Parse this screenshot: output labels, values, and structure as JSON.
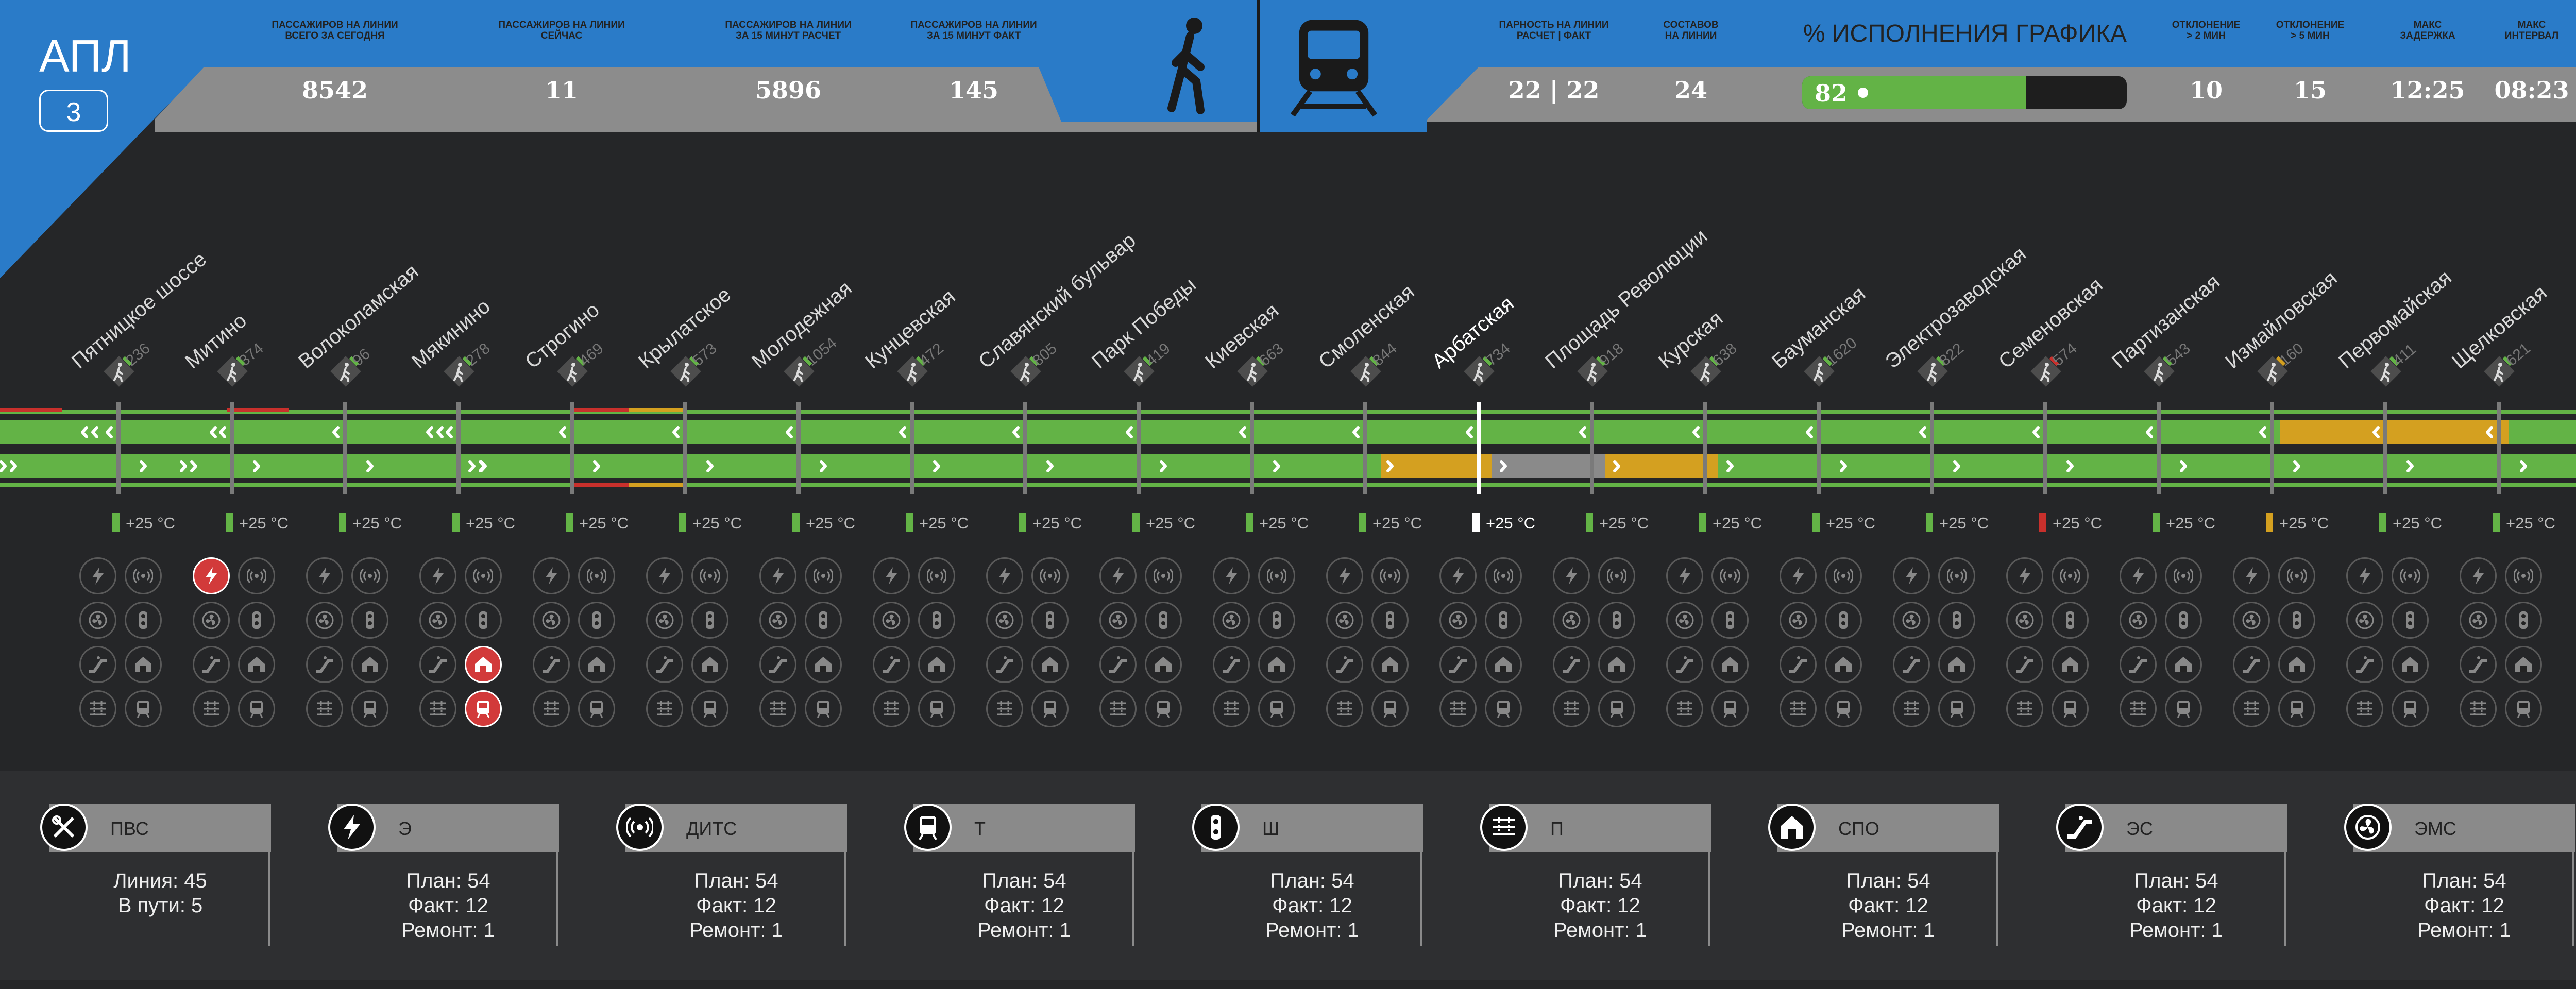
{
  "line": {
    "name": "АПЛ",
    "number": "3"
  },
  "passenger_kpis": [
    {
      "label": "ПАССАЖИРОВ НА ЛИНИИ\nВСЕГО ЗА СЕГОДНЯ",
      "value": "8542"
    },
    {
      "label": "ПАССАЖИРОВ НА ЛИНИИ\nСЕЙЧАС",
      "value": "11"
    },
    {
      "label": "ПАССАЖИРОВ НА ЛИНИИ\nЗА 15 МИНУТ РАСЧЕТ",
      "value": "5896"
    },
    {
      "label": "ПАССАЖИРОВ НА ЛИНИИ\nЗА 15 МИНУТ ФАКТ",
      "value": "145"
    }
  ],
  "train_kpis": [
    {
      "label": "ПАРНОСТЬ НА ЛИНИИ\nРАСЧЕТ | ФАКТ",
      "value": "22 | 22"
    },
    {
      "label": "СОСТАВОВ\nНА ЛИНИИ",
      "value": "24"
    }
  ],
  "schedule": {
    "title": "% ИСПОЛНЕНИЯ ГРАФИКА",
    "value": "82",
    "percent": 82
  },
  "train_kpis_right": [
    {
      "label": "ОТКЛОНЕНИЕ\n> 2 мин",
      "value": "10"
    },
    {
      "label": "ОТКЛОНЕНИЕ\n> 5 мин",
      "value": "15"
    },
    {
      "label": "МАКС\nЗАДЕРЖКА",
      "value": "12:25"
    },
    {
      "label": "МАКС\nИНТЕРВАЛ",
      "value": "08:23"
    }
  ],
  "colors": {
    "blue": "#2a7bc8",
    "green": "#63b346",
    "amber": "#d4a020",
    "red": "#c8302c",
    "gray": "#8a8a8a"
  },
  "stations": [
    {
      "name": "Пятницкое шоссе",
      "count": "236",
      "temp": "+25 °C",
      "flag": "green"
    },
    {
      "name": "Митино",
      "count": "374",
      "temp": "+25 °C",
      "flag": "green"
    },
    {
      "name": "Волоколамская",
      "count": "96",
      "temp": "+25 °C",
      "flag": "green"
    },
    {
      "name": "Мякинино",
      "count": "278",
      "temp": "+25 °C",
      "flag": "green"
    },
    {
      "name": "Строгино",
      "count": "469",
      "temp": "+25 °C",
      "flag": "green"
    },
    {
      "name": "Крылатское",
      "count": "573",
      "temp": "+25 °C",
      "flag": "green"
    },
    {
      "name": "Молодежная",
      "count": "1054",
      "temp": "+25 °C",
      "flag": "green"
    },
    {
      "name": "Кунцевская",
      "count": "472",
      "temp": "+25 °C",
      "flag": "green"
    },
    {
      "name": "Славянский бульвар",
      "count": "805",
      "temp": "+25 °C",
      "flag": "green"
    },
    {
      "name": "Парк Победы",
      "count": "419",
      "temp": "+25 °C",
      "flag": "green"
    },
    {
      "name": "Киевская",
      "count": "663",
      "temp": "+25 °C",
      "flag": "green"
    },
    {
      "name": "Смоленская",
      "count": "844",
      "temp": "+25 °C",
      "flag": "green"
    },
    {
      "name": "Арбатская",
      "count": "734",
      "temp": "+25 °C",
      "flag": "white"
    },
    {
      "name": "Площадь Революции",
      "count": "918",
      "temp": "+25 °C",
      "flag": "green"
    },
    {
      "name": "Курская",
      "count": "638",
      "temp": "+25 °C",
      "flag": "green"
    },
    {
      "name": "Бауманская",
      "count": "1620",
      "temp": "+25 °C",
      "flag": "green"
    },
    {
      "name": "Электрозаводская",
      "count": "822",
      "temp": "+25 °C",
      "flag": "green"
    },
    {
      "name": "Семеновская",
      "count": "574",
      "temp": "+25 °C",
      "flag": "red"
    },
    {
      "name": "Партизанская",
      "count": "543",
      "temp": "+25 °C",
      "flag": "green"
    },
    {
      "name": "Измайловская",
      "count": "160",
      "temp": "+25 °C",
      "flag": "amber"
    },
    {
      "name": "Первомайская",
      "count": "411",
      "temp": "+25 °C",
      "flag": "green"
    },
    {
      "name": "Щелковская",
      "count": "621",
      "temp": "+25 °C",
      "flag": "green"
    }
  ],
  "alarms": {
    "Митино": [
      "power"
    ],
    "Мякинино": [
      "shelter",
      "train"
    ]
  },
  "services": [
    {
      "code": "ПВС",
      "icon": "tools-icon",
      "lines": [
        "Линия: 45",
        "В пути: 5"
      ]
    },
    {
      "code": "Э",
      "icon": "lightning-icon",
      "lines": [
        "План: 54",
        "Факт: 12",
        "Ремонт: 1"
      ]
    },
    {
      "code": "ДИТС",
      "icon": "signal-icon",
      "lines": [
        "План: 54",
        "Факт: 12",
        "Ремонт: 1"
      ]
    },
    {
      "code": "Т",
      "icon": "train-icon",
      "lines": [
        "План: 54",
        "Факт: 12",
        "Ремонт: 1"
      ]
    },
    {
      "code": "Ш",
      "icon": "traffic-light-icon",
      "lines": [
        "План: 54",
        "Факт: 12",
        "Ремонт: 1"
      ]
    },
    {
      "code": "П",
      "icon": "track-icon",
      "lines": [
        "План: 54",
        "Факт: 12",
        "Ремонт: 1"
      ]
    },
    {
      "code": "СПО",
      "icon": "shelter-icon",
      "lines": [
        "План: 54",
        "Факт: 12",
        "Ремонт: 1"
      ]
    },
    {
      "code": "ЭС",
      "icon": "escalator-icon",
      "lines": [
        "План: 54",
        "Факт: 12",
        "Ремонт: 1"
      ]
    },
    {
      "code": "ЭМС",
      "icon": "fan-icon",
      "lines": [
        "План: 54",
        "Факт: 12",
        "Ремонт: 1"
      ]
    }
  ]
}
